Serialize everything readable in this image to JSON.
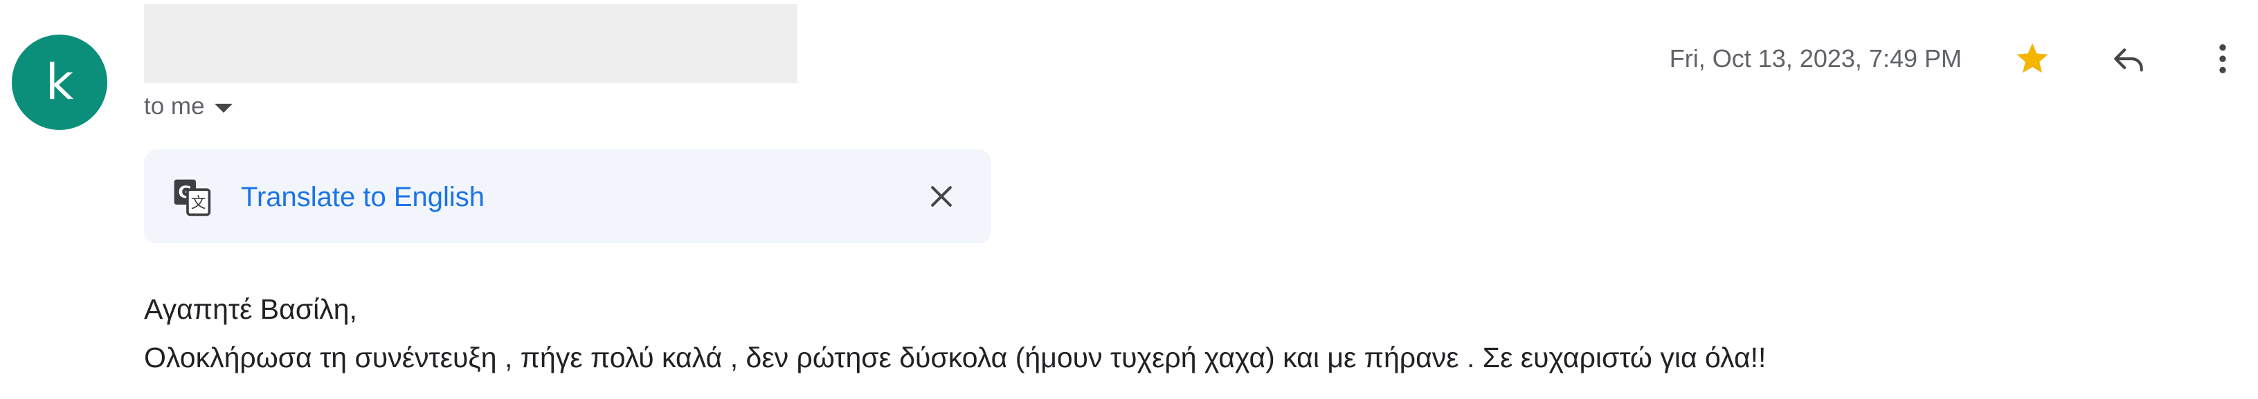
{
  "sender": {
    "avatar_letter": "k",
    "avatar_color": "#0b8f7a",
    "recipient_label": "to me"
  },
  "header": {
    "date": "Fri, Oct 13, 2023, 7:49 PM",
    "star_icon": "star-icon",
    "star_color": "#f4b400",
    "reply_icon": "reply-icon",
    "more_icon": "more-vert-icon"
  },
  "translate": {
    "label": "Translate to English",
    "icon": "translate-icon",
    "close_icon": "close-icon"
  },
  "message": {
    "greeting": "Αγαπητέ Βασίλη,",
    "line1": "Ολοκλήρωσα τη συνέντευξη , πήγε πολύ καλά , δεν ρώτησε δύσκολα (ήμουν τυχερή χαχα) και με πήρανε . Σε ευχαριστώ για όλα!!"
  }
}
